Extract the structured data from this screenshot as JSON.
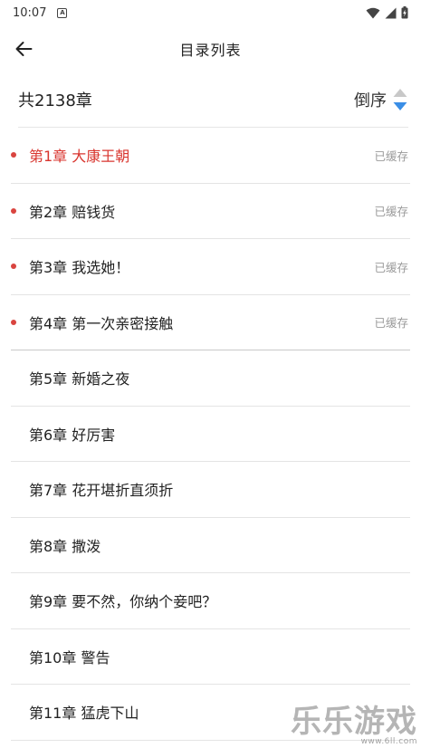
{
  "status_bar": {
    "time": "10:07",
    "notification_icon": "A"
  },
  "header": {
    "title": "目录列表",
    "back_icon": "arrow-left-icon"
  },
  "summary": {
    "count_text": "共2138章",
    "sort_label": "倒序"
  },
  "colors": {
    "accent_red": "#d9362f",
    "sort_blue": "#3a8ee6",
    "sort_grey": "#c8c8c8"
  },
  "chapters": [
    {
      "title": "第1章 大康王朝",
      "cached": true,
      "status": "已缓存",
      "current": true
    },
    {
      "title": "第2章 赔钱货",
      "cached": true,
      "status": "已缓存",
      "current": false
    },
    {
      "title": "第3章 我选她！",
      "cached": true,
      "status": "已缓存",
      "current": false
    },
    {
      "title": "第4章 第一次亲密接触",
      "cached": true,
      "status": "已缓存",
      "current": false
    },
    {
      "title": "第5章 新婚之夜",
      "cached": false,
      "status": "",
      "current": false
    },
    {
      "title": "第6章 好厉害",
      "cached": false,
      "status": "",
      "current": false
    },
    {
      "title": "第7章 花开堪折直须折",
      "cached": false,
      "status": "",
      "current": false
    },
    {
      "title": "第8章 撒泼",
      "cached": false,
      "status": "",
      "current": false
    },
    {
      "title": "第9章 要不然，你纳个妾吧？",
      "cached": false,
      "status": "",
      "current": false
    },
    {
      "title": "第10章 警告",
      "cached": false,
      "status": "",
      "current": false
    },
    {
      "title": "第11章 猛虎下山",
      "cached": false,
      "status": "",
      "current": false
    }
  ],
  "watermark": {
    "logo": "乐乐游戏",
    "url": "www.6ll.com"
  }
}
